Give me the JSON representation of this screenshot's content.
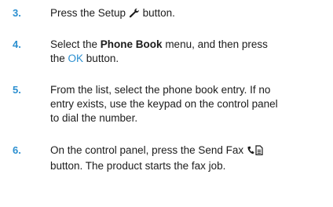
{
  "steps": [
    {
      "number": "3.",
      "pre": "Press the Setup ",
      "icon": "wrench-icon",
      "post": " button."
    },
    {
      "number": "4.",
      "pre": "Select the ",
      "bold": "Phone Book",
      "mid": " menu, and then press the ",
      "ok": "OK",
      "post": " button."
    },
    {
      "number": "5.",
      "text": "From the list, select the phone book entry. If no entry exists, use the keypad on the control panel to dial the number."
    },
    {
      "number": "6.",
      "pre": "On the control panel, press the Send Fax ",
      "icon": "send-fax-icon",
      "post": " button. The product starts the fax job."
    }
  ],
  "colors": {
    "accent": "#2b8fd0",
    "text": "#1c1c1c"
  }
}
